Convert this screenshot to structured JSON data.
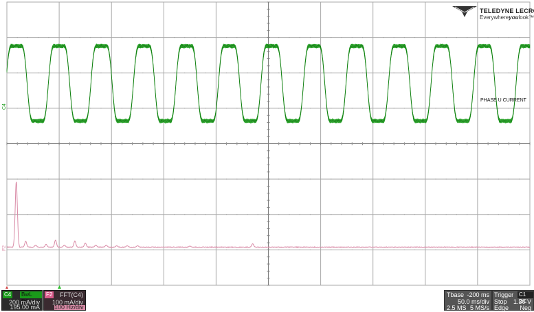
{
  "brand": {
    "name": "TELEDYNE LECROY",
    "tagline_prefix": "Everywhere",
    "tagline_bold": "you",
    "tagline_suffix": "look",
    "tagline_tm": "™"
  },
  "annotation": "PHASE U CURRENT",
  "trace_labels": {
    "c4": "C4",
    "f2": "F2"
  },
  "colors": {
    "c4": "#1a9a1a",
    "c4_dark": "#0d6b0d",
    "f2": "#d98aa6",
    "grid": "#a8a8a8",
    "background": "#ffffff"
  },
  "channels": {
    "c4": {
      "label": "C4",
      "coupling": "BwL DC",
      "scale": "200 mA/div",
      "offset": "195.00 mA"
    },
    "f2": {
      "label": "F2",
      "function": "FFT(C4)",
      "scale": "100 mA/div",
      "span": "100 Hz/div"
    }
  },
  "timebase": {
    "label": "Tbase",
    "delay": "-200 ms",
    "scale": "50.0 ms/div",
    "points": "2.5 MS",
    "rate": "5 MS/s"
  },
  "trigger": {
    "label": "Trigger",
    "tags": "C1 DC",
    "mode": "Stop",
    "level": "1.30 V",
    "type": "Edge",
    "slope": "Neg"
  },
  "chart_data": {
    "type": "line",
    "title": "",
    "xlabel": "",
    "ylabel": "",
    "grid": true,
    "divisions": {
      "x": 10,
      "y": 8
    },
    "series": [
      {
        "name": "C4",
        "kind": "waveform",
        "periods_on_screen": 12.3,
        "amplitude_div": 1.9,
        "center_div": 2.3,
        "ripple_div": 0.08
      },
      {
        "name": "F2",
        "kind": "fft",
        "fundamental_div": 0.2,
        "peak_div": 1.85,
        "harmonic_peaks_div": [
          0.05,
          0.02,
          0.03,
          0.2,
          0.09,
          0.07,
          0.03,
          0.02
        ]
      }
    ]
  }
}
